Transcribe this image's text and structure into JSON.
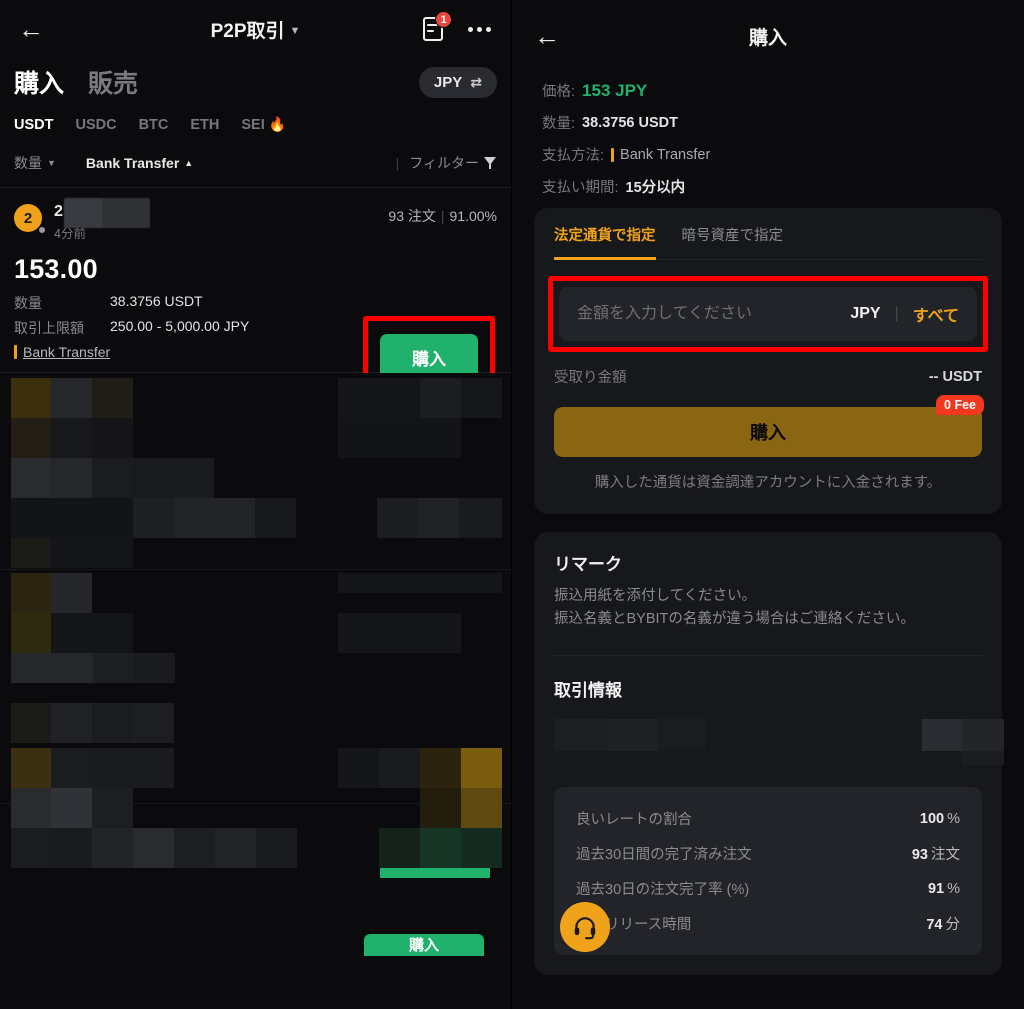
{
  "left": {
    "topbar": {
      "title": "P2P取引",
      "order_badge": "1"
    },
    "mode_tabs": [
      {
        "label": "購入",
        "active": true
      },
      {
        "label": "販売",
        "active": false
      }
    ],
    "fiat_pill": {
      "label": "JPY"
    },
    "coin_tabs": [
      {
        "label": "USDT",
        "active": true
      },
      {
        "label": "USDC",
        "active": false
      },
      {
        "label": "BTC",
        "active": false
      },
      {
        "label": "ETH",
        "active": false
      },
      {
        "label": "SEI",
        "active": false,
        "hot": true
      }
    ],
    "filters": {
      "amount": "数量",
      "payment": "Bank Transfer",
      "filter": "フィルター"
    },
    "offer": {
      "avatar_initial": "2",
      "seller_name": "2",
      "last_seen": "4分前",
      "orders": "93 注文",
      "completion": "91.00%",
      "price": "153.00",
      "qty_label": "数量",
      "qty_value": "38.3756 USDT",
      "limit_label": "取引上限額",
      "limit_value": "250.00 - 5,000.00 JPY",
      "payment_method": "Bank Transfer",
      "buy_label": "購入"
    },
    "bottom_buy_label": "購入"
  },
  "right": {
    "title": "購入",
    "details": [
      {
        "label": "価格:",
        "value": "153 JPY",
        "style": "green"
      },
      {
        "label": "数量:",
        "value": "38.3756 USDT",
        "style": "normal"
      },
      {
        "label": "支払方法:",
        "value": "Bank Transfer",
        "style": "muted",
        "bar": true
      },
      {
        "label": "支払い期間:",
        "value": "15分以内",
        "style": "normal"
      }
    ],
    "form": {
      "tabs": [
        {
          "label": "法定通貨で指定",
          "active": true
        },
        {
          "label": "暗号資産で指定",
          "active": false
        }
      ],
      "amount_placeholder": "金額を入力してください",
      "amount_value": "",
      "currency": "JPY",
      "all_label": "すべて",
      "receive_label": "受取り金額",
      "receive_value": "-- USDT",
      "submit_label": "購入",
      "fee_badge": "0 Fee",
      "note": "購入した通貨は資金調達アカウントに入金されます。"
    },
    "remark": {
      "title": "リマーク",
      "lines": [
        "振込用紙を添付してください。",
        "振込名義とBYBITの名義が違う場合はご連絡ください。"
      ]
    },
    "trade_info": {
      "title": "取引情報",
      "stats": [
        {
          "label": "良いレートの割合",
          "value": "100",
          "unit": "%"
        },
        {
          "label": "過去30日間の完了済み注文",
          "value": "93",
          "unit": "注文"
        },
        {
          "label": "過去30日の注文完了率 (%)",
          "value": "91",
          "unit": "%"
        },
        {
          "label": "平均リリース時間",
          "value": "74",
          "unit": "分"
        }
      ]
    },
    "support_fab": "headset-icon"
  },
  "colors": {
    "accent_gold": "#f0a21b",
    "buy_green": "#20b26c",
    "highlight_red": "#ff0000",
    "badge_red": "#e8453c",
    "fee_red": "#f2371f"
  }
}
